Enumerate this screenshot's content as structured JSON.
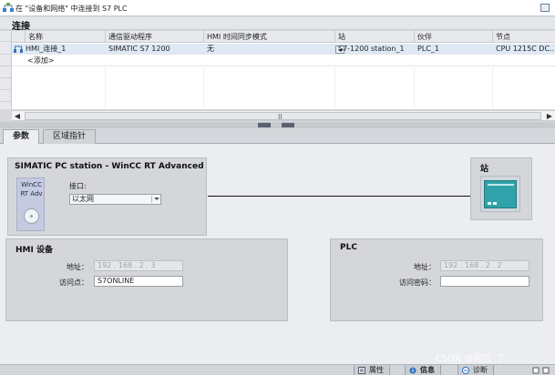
{
  "header": {
    "title": "在 \"设备和网络\" 中连接到 S7 PLC"
  },
  "connections": {
    "section_title": "连接",
    "columns": [
      "名称",
      "通信驱动程序",
      "HMI 时间同步模式",
      "站",
      "伙伴",
      "节点"
    ],
    "rows": [
      [
        "HMI_连接_1",
        "SIMATIC S7 1200",
        "无",
        "S7-1200 station_1",
        "PLC_1",
        "CPU 1215C DC..."
      ]
    ],
    "add_row_label": "<添加>",
    "scroll_grip": "II"
  },
  "tabs": [
    {
      "label": "参数",
      "active": true
    },
    {
      "label": "区域指针",
      "active": false
    }
  ],
  "pc_station": {
    "title": "SIMATIC PC station - WinCC RT Advanced",
    "device_label_line1": "WinCC",
    "device_label_line2": "RT Adv",
    "interface_label": "接口:",
    "interface_value": "以太网"
  },
  "station": {
    "title": "站"
  },
  "hmi_device": {
    "title": "HMI 设备",
    "address_label": "地址：",
    "address_value": "192 . 168 . 2 . 3",
    "access_point_label": "访问点：",
    "access_point_value": "S7ONLINE"
  },
  "plc": {
    "title": "PLC",
    "address_label": "地址：",
    "address_value": "192 . 168 . 2 . 2",
    "access_password_label": "访问密码：",
    "access_password_value": ""
  },
  "status_bar": {
    "properties_label": "属性",
    "info_label": "信息",
    "diagnostics_label": "诊断"
  },
  "watermark": "CSDN @阿拉_丁",
  "colors": {
    "selected_row": "#dfe9f6",
    "plc_accent": "#2fa3a9",
    "panel_bg": "#d4d6da"
  }
}
